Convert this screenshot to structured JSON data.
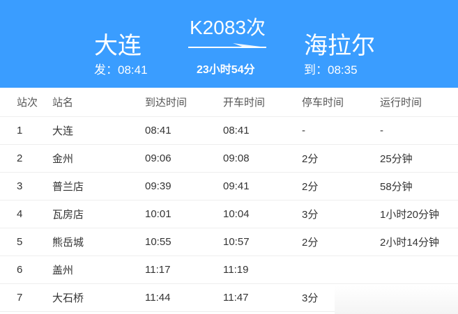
{
  "header": {
    "from": "大连",
    "to": "海拉尔",
    "train": "K2083次",
    "duration": "23小时54分",
    "depart": "发：08:41",
    "arrive": "到：08:35"
  },
  "columns": [
    "站次",
    "站名",
    "到达时间",
    "开车时间",
    "停车时间",
    "运行时间"
  ],
  "rows": [
    [
      "1",
      "大连",
      "08:41",
      "08:41",
      "-",
      "-"
    ],
    [
      "2",
      "金州",
      "09:06",
      "09:08",
      "2分",
      "25分钟"
    ],
    [
      "3",
      "普兰店",
      "09:39",
      "09:41",
      "2分",
      "58分钟"
    ],
    [
      "4",
      "瓦房店",
      "10:01",
      "10:04",
      "3分",
      "1小时20分钟"
    ],
    [
      "5",
      "熊岳城",
      "10:55",
      "10:57",
      "2分",
      "2小时14分钟"
    ],
    [
      "6",
      "盖州",
      "11:17",
      "11:19",
      "",
      ""
    ],
    [
      "7",
      "大石桥",
      "11:44",
      "11:47",
      "3分",
      ""
    ]
  ]
}
